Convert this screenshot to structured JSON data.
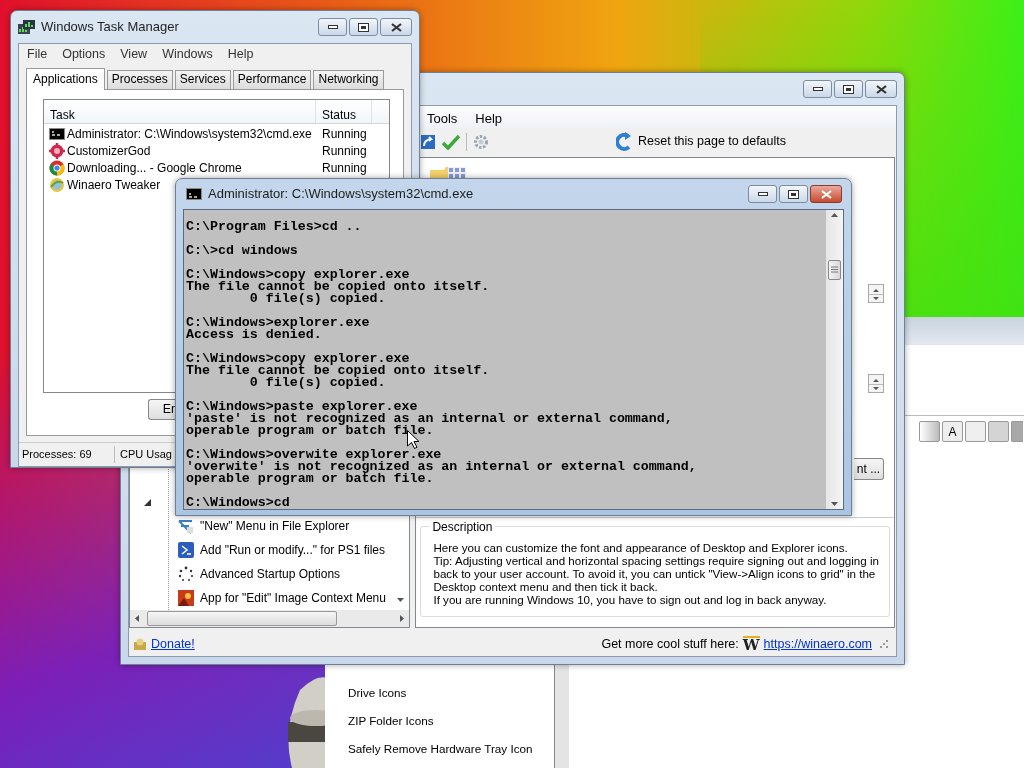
{
  "task_manager": {
    "title": "Windows Task Manager",
    "menu": [
      "File",
      "Options",
      "View",
      "Windows",
      "Help"
    ],
    "tabs": [
      {
        "label": "Applications",
        "selected": true
      },
      {
        "label": "Processes",
        "selected": false
      },
      {
        "label": "Services",
        "selected": false
      },
      {
        "label": "Performance",
        "selected": false
      },
      {
        "label": "Networking",
        "selected": false
      }
    ],
    "columns": [
      "Task",
      "Status"
    ],
    "rows": [
      {
        "task": "Administrator: C:\\Windows\\system32\\cmd.exe",
        "status": "Running"
      },
      {
        "task": "CustomizerGod",
        "status": "Running"
      },
      {
        "task": "Downloading... - Google Chrome",
        "status": "Running"
      },
      {
        "task": "Winaero Tweaker"
      }
    ],
    "end_button": "En",
    "status_bar": [
      "Processes: 69",
      "CPU Usag"
    ]
  },
  "tweaker": {
    "menu": [
      "Tools",
      "Help"
    ],
    "reset_link": "Reset this page to defaults",
    "tree_items": [
      "\"New\" Menu in File Explorer",
      "Add \"Run or modify...\" for PS1 files",
      "Advanced Startup Options",
      "App for \"Edit\" Image Context Menu"
    ],
    "font_button": "nt ...",
    "description": {
      "title": "Description",
      "lines": [
        "Here you can customize the font and appearance of Desktop and Explorer icons.",
        "Tip: Adjusting vertical and horizontal spacing settings require signing out and logging in",
        "back to your user account. To avoid it, you can untick \"View->Align icons to grid\" in the",
        "Desktop context menu and then tick it back.",
        "If you are running Windows 10, you have to sign out and log in back anyway."
      ]
    },
    "footer": {
      "donate": "Donate!",
      "promo": "Get more cool stuff here:",
      "logo": "W",
      "link": "https://winaero.com"
    }
  },
  "cmd": {
    "title": "Administrator: C:\\Windows\\system32\\cmd.exe",
    "blocks": [
      [
        "C:\\Program Files>cd .."
      ],
      [
        "C:\\>cd windows"
      ],
      [
        "C:\\Windows>copy explorer.exe",
        "The file cannot be copied onto itself.",
        "        0 file(s) copied."
      ],
      [
        "C:\\Windows>explorer.exe",
        "Access is denied."
      ],
      [
        "C:\\Windows>copy explorer.exe",
        "The file cannot be copied onto itself.",
        "        0 file(s) copied."
      ],
      [
        "C:\\Windows>paste explorer.exe",
        "'paste' is not recognized as an internal or external command,",
        "operable program or batch file."
      ],
      [
        "C:\\Windows>overwite explorer.exe",
        "'overwite' is not recognized as an internal or external command,",
        "operable program or batch file."
      ],
      [
        "C:\\Windows>cd"
      ]
    ]
  },
  "back_window": {
    "list_items": [
      "Drive Icons",
      "ZIP Folder Icons",
      "Safely Remove Hardware Tray Icon"
    ],
    "swatch_label": "A"
  }
}
